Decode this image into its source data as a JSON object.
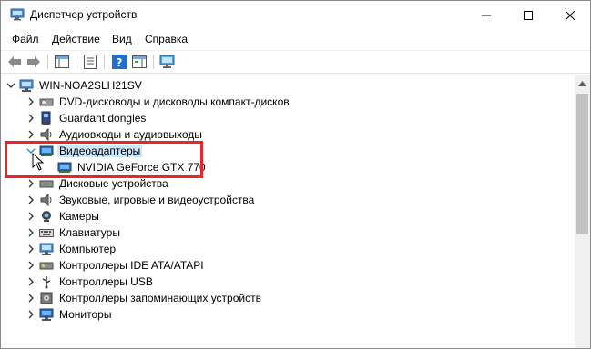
{
  "window": {
    "title": "Диспетчер устройств"
  },
  "menu": [
    "Файл",
    "Действие",
    "Вид",
    "Справка"
  ],
  "tree": {
    "root": "WIN-NOA2SLH21SV",
    "items": [
      {
        "label": "DVD-дисководы и дисководы компакт-дисков",
        "icon": "dvd-drive-icon",
        "expanded": false
      },
      {
        "label": "Guardant dongles",
        "icon": "dongle-icon",
        "expanded": false
      },
      {
        "label": "Аудиовходы и аудиовыходы",
        "icon": "speaker-icon",
        "expanded": false
      },
      {
        "label": "Видеоадаптеры",
        "icon": "display-adapter-icon",
        "expanded": true,
        "selected": true,
        "children": [
          {
            "label": "NVIDIA GeForce GTX 770",
            "icon": "display-adapter-icon"
          }
        ]
      },
      {
        "label": "Дисковые устройства",
        "icon": "disk-drive-icon",
        "expanded": false
      },
      {
        "label": "Звуковые, игровые и видеоустройства",
        "icon": "speaker-icon",
        "expanded": false
      },
      {
        "label": "Камеры",
        "icon": "camera-icon",
        "expanded": false
      },
      {
        "label": "Клавиатуры",
        "icon": "keyboard-icon",
        "expanded": false
      },
      {
        "label": "Компьютер",
        "icon": "computer-icon",
        "expanded": false
      },
      {
        "label": "Контроллеры IDE ATA/ATAPI",
        "icon": "ide-controller-icon",
        "expanded": false
      },
      {
        "label": "Контроллеры USB",
        "icon": "usb-controller-icon",
        "expanded": false
      },
      {
        "label": "Контроллеры запоминающих устройств",
        "icon": "storage-controller-icon",
        "expanded": false
      },
      {
        "label": "Мониторы",
        "icon": "monitor-icon",
        "expanded": false
      }
    ]
  },
  "colors": {
    "selection": "#cce8ff",
    "highlight_border": "#e8262a",
    "toolbar_blue": "#1e6fd1"
  }
}
